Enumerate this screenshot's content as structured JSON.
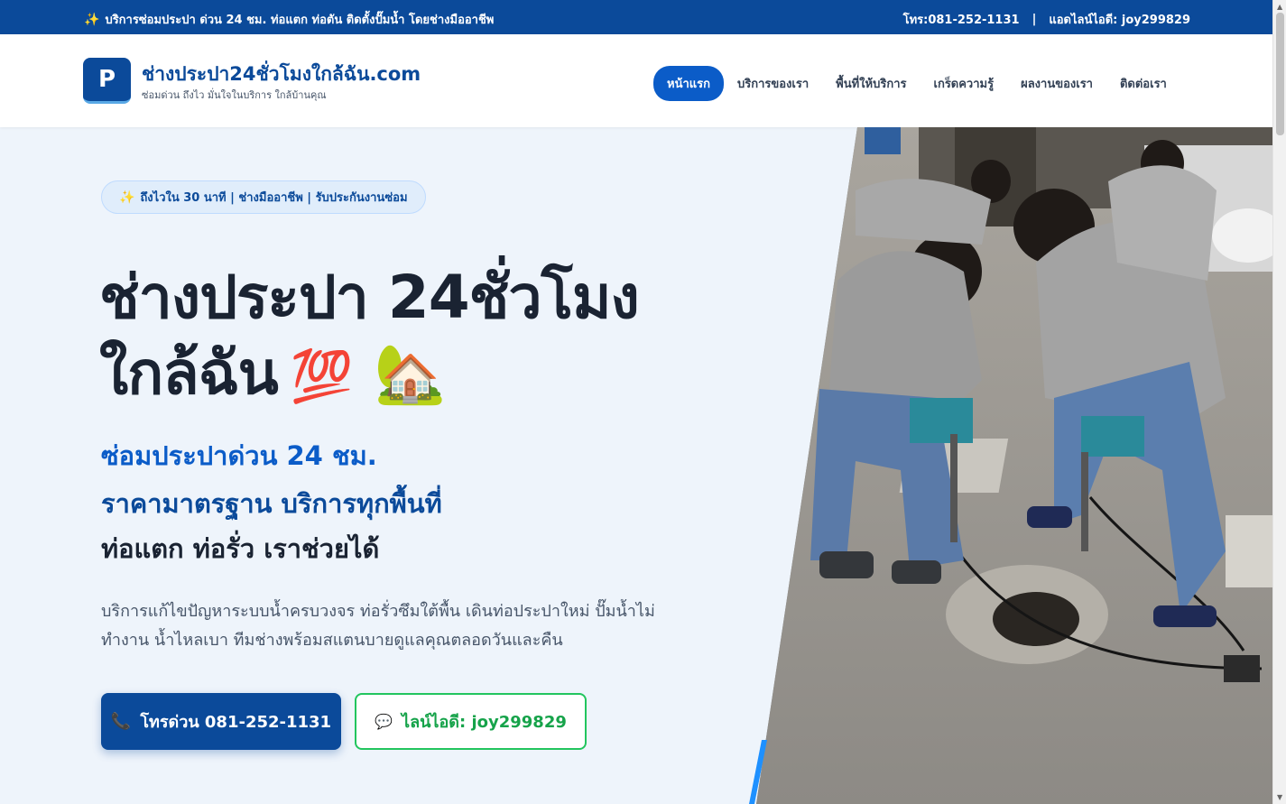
{
  "topbar": {
    "announcement": "บริการซ่อมประปา ด่วน 24 ชม. ท่อแตก ท่อตัน ติดตั้งปั๊มน้ำ โดยช่างมืออาชีพ",
    "phone": "โทร:081-252-1131",
    "separator": "|",
    "line": "แอดไลน์ไอดี: joy299829"
  },
  "brand": {
    "logo_letter": "P",
    "title": "ช่างประปา24ชั่วโมงใกล้ฉัน.com",
    "tagline": "ซ่อมด่วน ถึงไว มั่นใจในบริการ ใกล้บ้านคุณ"
  },
  "nav": {
    "items": [
      {
        "label": "หน้าแรก",
        "active": true
      },
      {
        "label": "บริการของเรา",
        "active": false
      },
      {
        "label": "พื้นที่ให้บริการ",
        "active": false
      },
      {
        "label": "เกร็ดความรู้",
        "active": false
      },
      {
        "label": "ผลงานของเรา",
        "active": false
      },
      {
        "label": "ติดต่อเรา",
        "active": false
      }
    ]
  },
  "hero": {
    "badge": "ถึงไวใน 30 นาที | ช่างมืออาชีพ | รับประกันงานซ่อม",
    "title_line1": "ช่างประปา 24ชั่วโมง",
    "title_line2": "ใกล้ฉัน",
    "title_emoji1": "💯",
    "title_emoji2": "🏡",
    "subtitle1": "ซ่อมประปาด่วน 24 ชม.",
    "subtitle2": "ราคามาตรฐาน บริการทุกพื้นที่",
    "subtitle3": "ท่อแตก ท่อรั่ว เราช่วยได้",
    "description": "บริการแก้ไขปัญหาระบบน้ำครบวงจร ท่อรั่วซึมใต้พื้น เดินท่อประปาใหม่ ปั๊มน้ำไม่ทำงาน น้ำไหลเบา ทีมช่างพร้อมสแตนบายดูแลคุณตลอดวันและคืน",
    "call_button": "โทรด่วน 081-252-1131",
    "line_button": "ไลน์ไอดี: joy299829"
  },
  "icons": {
    "sparkle": "✨",
    "phone": "📞",
    "chat": "💬"
  },
  "colors": {
    "primary": "#0b4a9a",
    "accent": "#0b5cc8",
    "line_green": "#22c55e",
    "background": "#eef4fb"
  }
}
